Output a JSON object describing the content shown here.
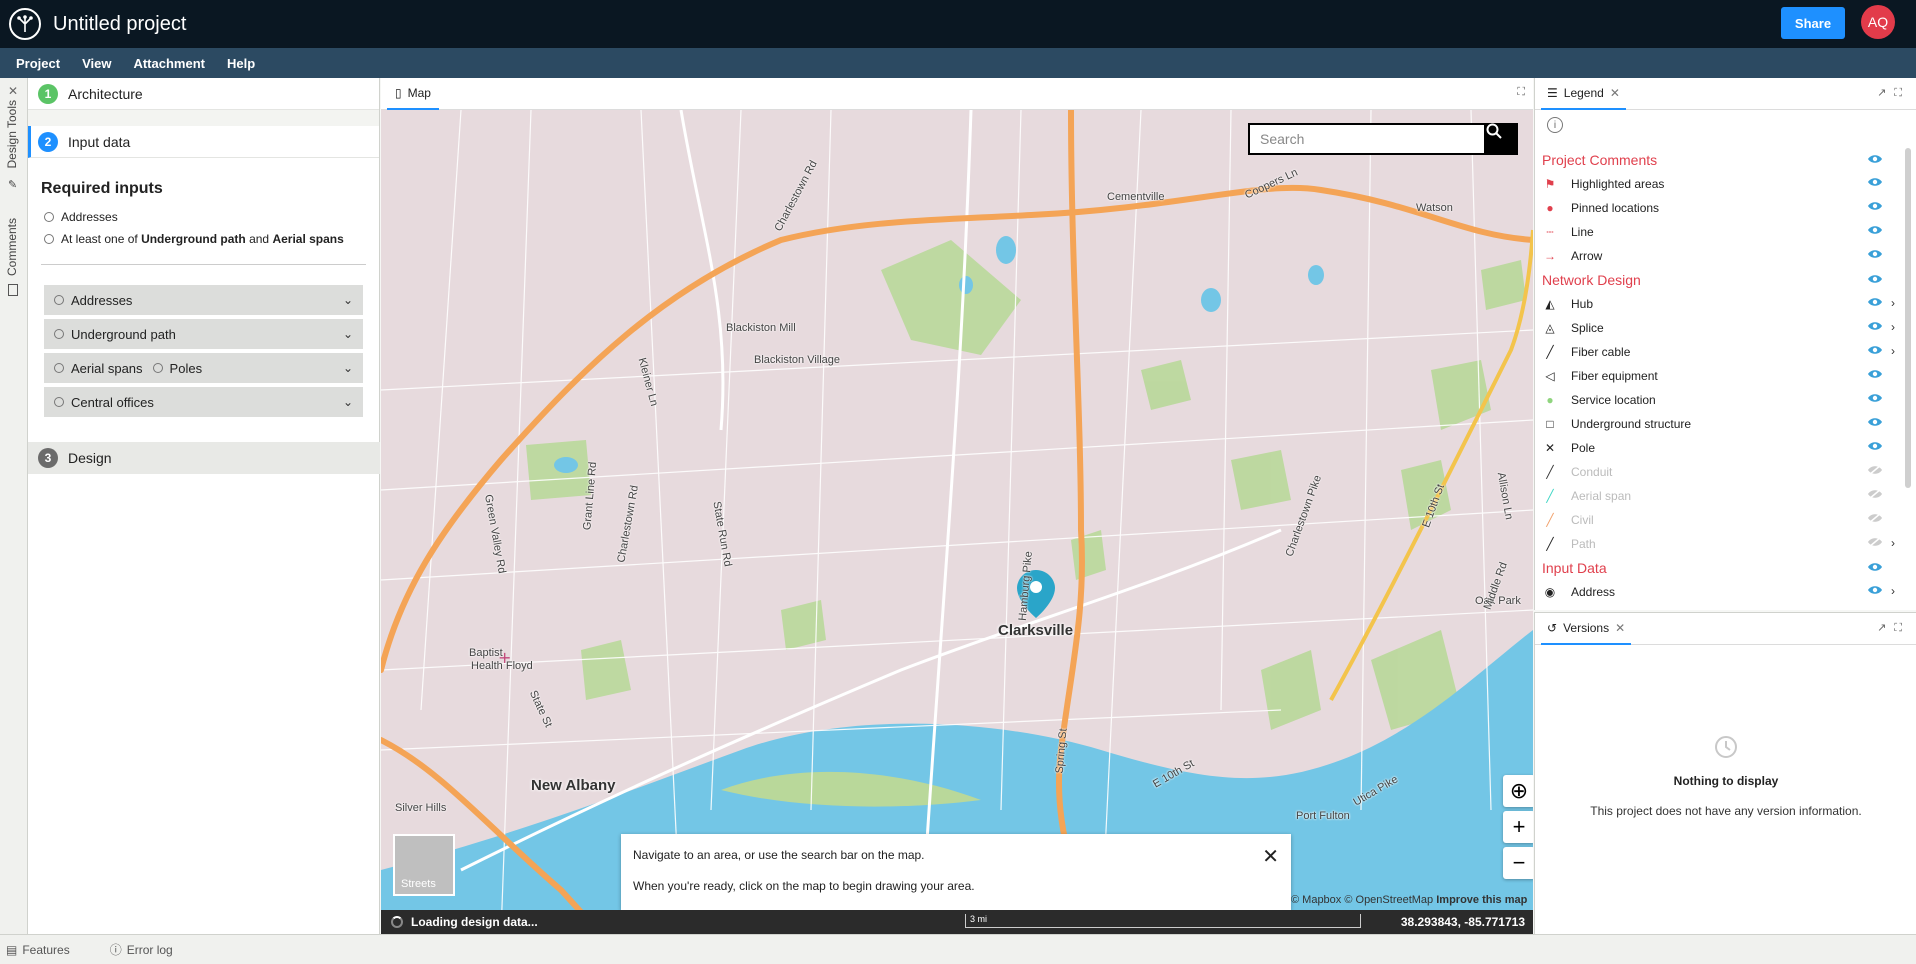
{
  "app": {
    "title": "Untitled project",
    "share_label": "Share",
    "avatar_initials": "AQ"
  },
  "menu": [
    "Project",
    "View",
    "Attachment",
    "Help"
  ],
  "rail": {
    "design_tools": "Design Tools",
    "comments": "Comments"
  },
  "steps": {
    "architecture": {
      "num": "1",
      "label": "Architecture",
      "color": "#5bc466"
    },
    "input_data": {
      "num": "2",
      "label": "Input data",
      "color": "#1e90ff"
    },
    "design": {
      "num": "3",
      "label": "Design",
      "color": "#6b6b6b"
    }
  },
  "required": {
    "title": "Required inputs",
    "item1": "Addresses",
    "item2_prefix": "At least one of",
    "item2_a": "Underground path",
    "item2_and": "and",
    "item2_b": "Aerial spans"
  },
  "accordions": {
    "addresses": "Addresses",
    "underground": "Underground path",
    "aerial": "Aerial spans",
    "poles": "Poles",
    "central": "Central offices"
  },
  "map": {
    "tab_label": "Map",
    "search_placeholder": "Search",
    "labels": {
      "clarksville": "Clarksville",
      "new_albany": "New Albany",
      "silver_hills": "Silver Hills",
      "blackiston_mill": "Blackiston Mill",
      "blackiston_village": "Blackiston Village",
      "cementville": "Cementville",
      "watson": "Watson",
      "oak_park": "Oak Park",
      "port_fulton": "Port Fulton",
      "baptist": "Baptist",
      "health_floyd": "Health Floyd",
      "charlestown_rd": "Charlestown Rd",
      "grant_line_rd": "Grant Line Rd",
      "green_valley_rd": "Green Valley Rd",
      "state_run_rd": "State Run Rd",
      "hamburg_pike": "Hamburg Pike",
      "e_10th_st": "E 10th St",
      "allison_ln": "Allison Ln",
      "middle_rd": "Middle Rd",
      "utica_pike": "Utica Pike",
      "spring_st": "Spring St",
      "coopers_ln": "Coopers Ln",
      "charlestown_pike": "Charlestown Pike",
      "kleiner_ln": "Kleiner Ln",
      "state_st": "State St"
    },
    "basemap_label": "Streets",
    "toast_line1": "Navigate to an area, or use the search bar on the map.",
    "toast_line2": "When you're ready, click on the map to begin drawing your area.",
    "attribution": "© Mapbox © OpenStreetMap",
    "improve_link": "Improve this map",
    "loading": "Loading design data...",
    "scale": "3 mi",
    "coordinates": "38.293843, -85.771713"
  },
  "legend": {
    "tab_label": "Legend",
    "sections": {
      "project_comments": "Project Comments",
      "network_design": "Network Design",
      "input_data": "Input Data"
    },
    "items": {
      "highlighted": "Highlighted areas",
      "pinned": "Pinned locations",
      "line": "Line",
      "arrow": "Arrow",
      "hub": "Hub",
      "splice": "Splice",
      "fiber_cable": "Fiber cable",
      "fiber_equipment": "Fiber equipment",
      "service_location": "Service location",
      "underground_structure": "Underground structure",
      "pole": "Pole",
      "conduit": "Conduit",
      "aerial_span": "Aerial span",
      "civil": "Civil",
      "path": "Path",
      "address": "Address"
    },
    "eye_color": "#3aa0d8",
    "accent": "#e0404d"
  },
  "versions": {
    "tab_label": "Versions",
    "empty_title": "Nothing to display",
    "empty_desc": "This project does not have any version information."
  },
  "bottom": {
    "features": "Features",
    "error_log": "Error log"
  }
}
